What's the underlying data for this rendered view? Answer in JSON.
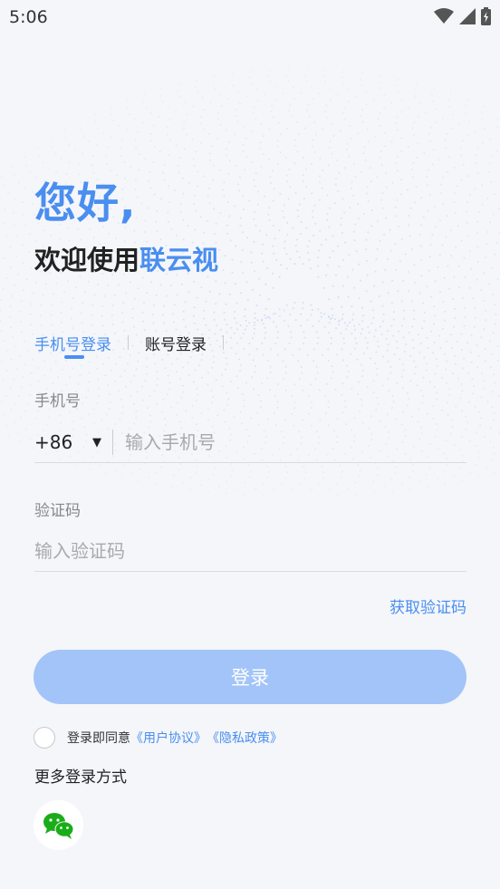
{
  "status_bar": {
    "time": "5:06"
  },
  "header": {
    "greeting": "您好,",
    "welcome_prefix": "欢迎使用",
    "brand_name": "联云视"
  },
  "tabs": [
    {
      "label": "手机号登录",
      "active": true
    },
    {
      "label": "账号登录",
      "active": false
    }
  ],
  "phone_field": {
    "label": "手机号",
    "country_code": "+86",
    "placeholder": "输入手机号",
    "value": ""
  },
  "code_field": {
    "label": "验证码",
    "placeholder": "输入验证码",
    "value": ""
  },
  "get_code_label": "获取验证码",
  "login_button_label": "登录",
  "agreement": {
    "prefix": "登录即同意",
    "user_agreement": "《用户协议》",
    "privacy_policy": "《隐私政策》",
    "checked": false
  },
  "more_login_label": "更多登录方式",
  "icons": {
    "wifi": "wifi-icon",
    "signal": "signal-icon",
    "battery": "battery-icon",
    "dropdown": "dropdown-arrow-icon",
    "wechat": "wechat-icon"
  },
  "colors": {
    "accent": "#4a8ef0",
    "button_disabled": "#a3c4f8",
    "background": "#f4f6fa",
    "wechat_green": "#1aad19"
  }
}
